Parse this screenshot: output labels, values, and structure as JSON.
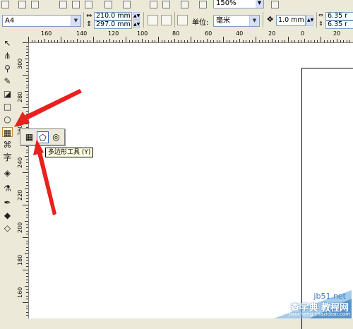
{
  "toolbar": {
    "zoom": "150%"
  },
  "property_bar": {
    "paper_size": "A4",
    "width": "210.0 mm",
    "height": "297.0 mm",
    "unit_label": "单位:",
    "unit_value": "毫米",
    "nudge": "1.0 mm",
    "dup_x": "6.35 r",
    "dup_y": "6.35 r"
  },
  "ruler_h": {
    "labels": [
      "160",
      "140",
      "120",
      "100",
      "80",
      "60",
      "40",
      "20",
      "0",
      "20"
    ]
  },
  "ruler_v": {
    "labels": [
      "300",
      "280",
      "260",
      "240",
      "220",
      "200",
      "180",
      "160"
    ]
  },
  "toolbox": {
    "tools": [
      "pick-tool",
      "shape-tool",
      "zoom-tool",
      "freehand-tool",
      "smart-fill-tool",
      "rectangle-tool",
      "ellipse-tool",
      "graph-paper-tool",
      "basic-shapes-tool",
      "text-tool",
      "interactive-blend-tool",
      "eyedropper-tool",
      "outline-tool",
      "fill-tool",
      "interactive-fill-tool"
    ]
  },
  "flyout": {
    "tooltip": "多边形工具 (Y)"
  },
  "watermark": {
    "site": "jb51.net",
    "text": "查字典 教程网",
    "url": "jiaocheng.chazidian.com"
  },
  "colors": {
    "arrow": "#e8201e",
    "chrome": "#ece9d8"
  }
}
